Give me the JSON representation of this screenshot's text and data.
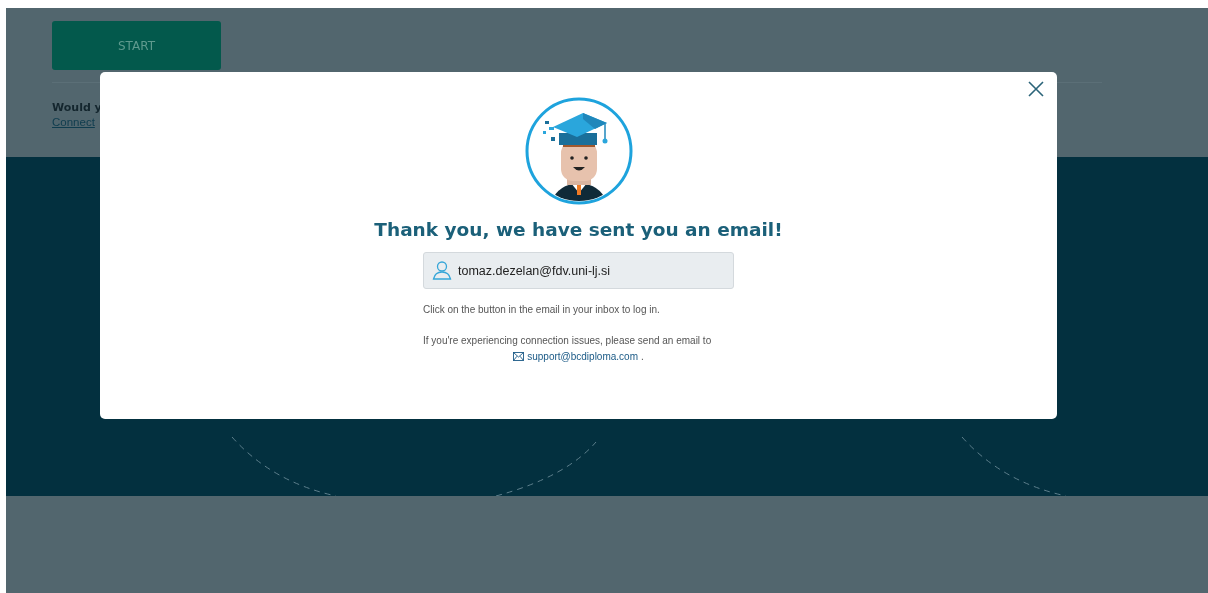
{
  "background": {
    "start_button": "START",
    "question": "Would y",
    "link": "Connect"
  },
  "dialog": {
    "title": "Thank you, we have sent you an email!",
    "email_field": {
      "value": "tomaz.dezelan@fdv.uni-lj.si"
    },
    "instruction": "Click on the button in the email in your inbox to log in.",
    "support_text": "If you're experiencing connection issues, please send an email to",
    "support_email": "support@bcdiploma.com",
    "support_suffix": "."
  }
}
